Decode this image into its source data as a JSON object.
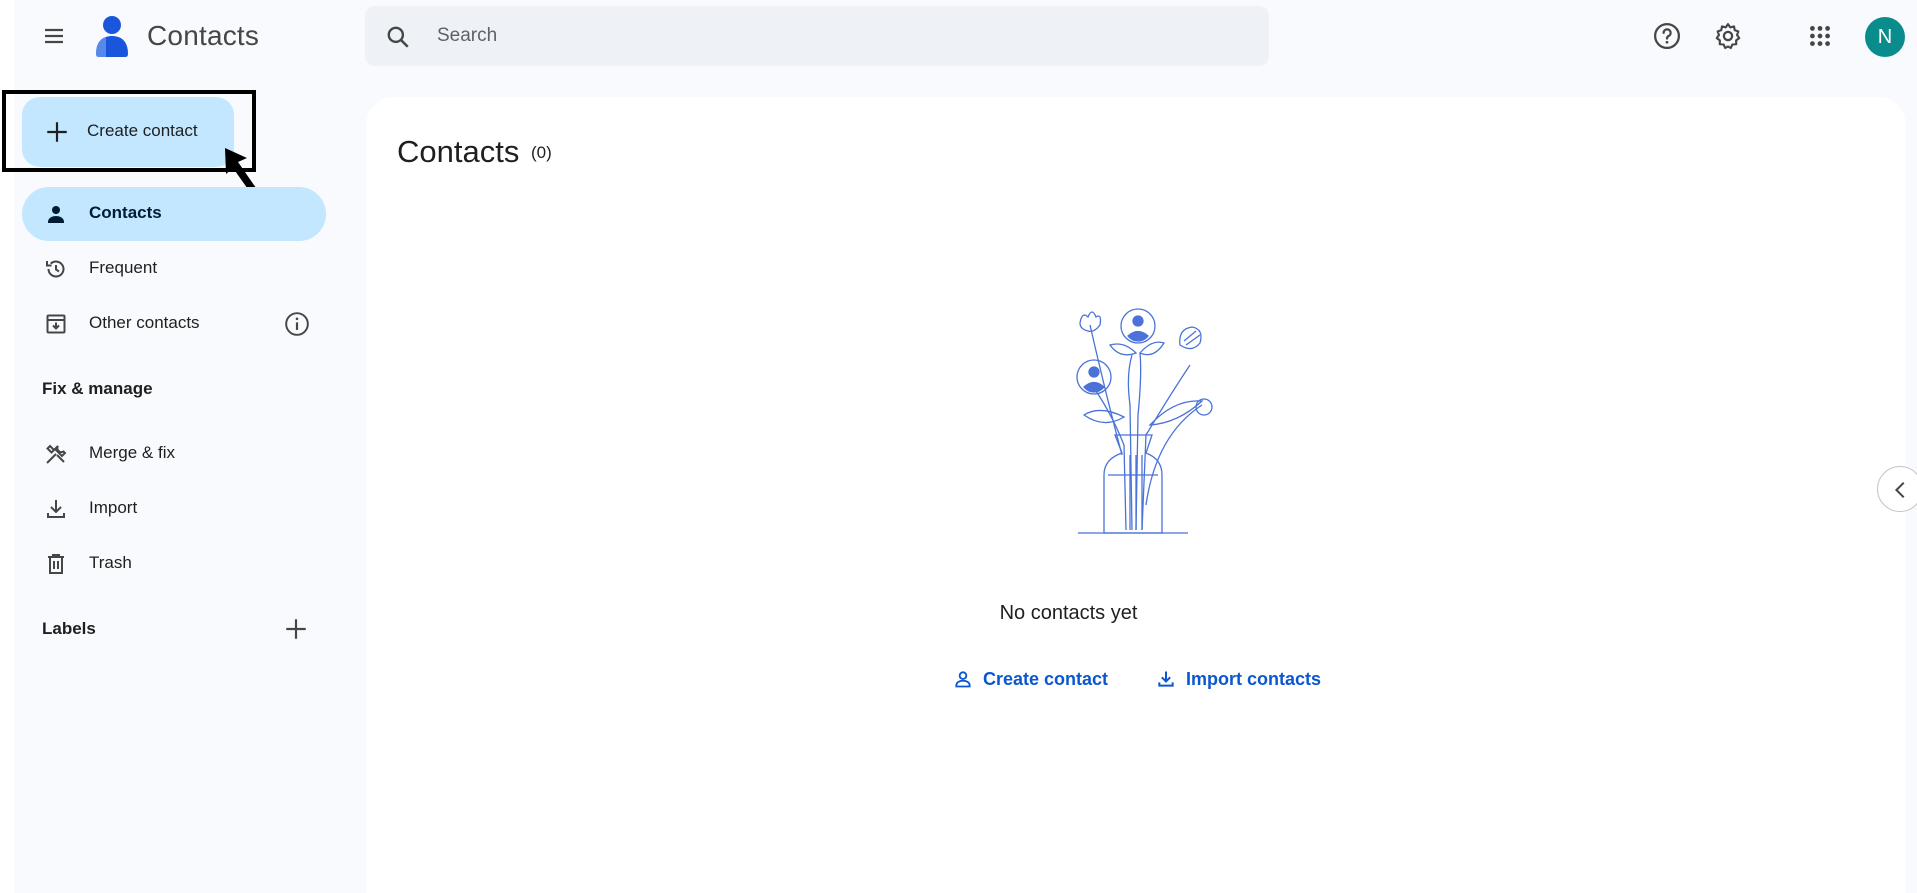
{
  "header": {
    "app_title": "Contacts",
    "search_placeholder": "Search",
    "avatar_initial": "N"
  },
  "sidebar": {
    "create_label": "Create contact",
    "items": [
      {
        "label": "Contacts",
        "icon": "person-icon",
        "active": true
      },
      {
        "label": "Frequent",
        "icon": "history-icon"
      },
      {
        "label": "Other contacts",
        "icon": "archive-download-icon"
      }
    ],
    "fix_manage_title": "Fix & manage",
    "fix_items": [
      {
        "label": "Merge & fix",
        "icon": "merge-fix-icon"
      },
      {
        "label": "Import",
        "icon": "download-icon"
      },
      {
        "label": "Trash",
        "icon": "trash-icon"
      }
    ],
    "labels_title": "Labels"
  },
  "main": {
    "title": "Contacts",
    "count": "(0)",
    "empty_message": "No contacts yet",
    "create_link": "Create contact",
    "import_link": "Import contacts"
  },
  "colors": {
    "accent": "#0b57d0",
    "active_bg": "#c2e7ff",
    "avatar_bg": "#0b8c8c",
    "illustration": "#4a72d9"
  }
}
